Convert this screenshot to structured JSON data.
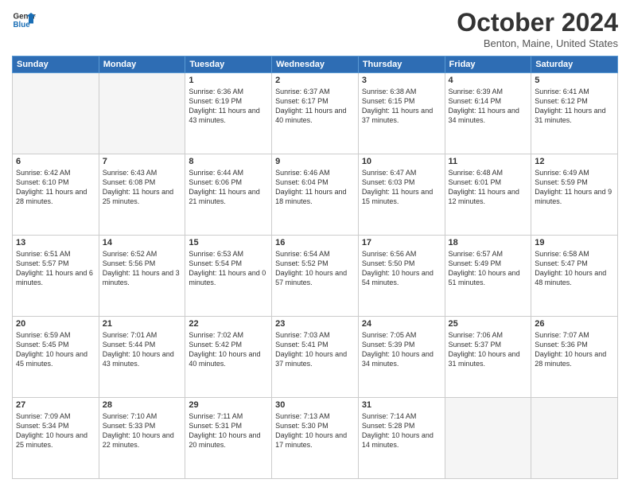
{
  "header": {
    "logo_line1": "General",
    "logo_line2": "Blue",
    "month": "October 2024",
    "location": "Benton, Maine, United States"
  },
  "weekdays": [
    "Sunday",
    "Monday",
    "Tuesday",
    "Wednesday",
    "Thursday",
    "Friday",
    "Saturday"
  ],
  "weeks": [
    [
      {
        "day": "",
        "info": ""
      },
      {
        "day": "",
        "info": ""
      },
      {
        "day": "1",
        "info": "Sunrise: 6:36 AM\nSunset: 6:19 PM\nDaylight: 11 hours\nand 43 minutes."
      },
      {
        "day": "2",
        "info": "Sunrise: 6:37 AM\nSunset: 6:17 PM\nDaylight: 11 hours\nand 40 minutes."
      },
      {
        "day": "3",
        "info": "Sunrise: 6:38 AM\nSunset: 6:15 PM\nDaylight: 11 hours\nand 37 minutes."
      },
      {
        "day": "4",
        "info": "Sunrise: 6:39 AM\nSunset: 6:14 PM\nDaylight: 11 hours\nand 34 minutes."
      },
      {
        "day": "5",
        "info": "Sunrise: 6:41 AM\nSunset: 6:12 PM\nDaylight: 11 hours\nand 31 minutes."
      }
    ],
    [
      {
        "day": "6",
        "info": "Sunrise: 6:42 AM\nSunset: 6:10 PM\nDaylight: 11 hours\nand 28 minutes."
      },
      {
        "day": "7",
        "info": "Sunrise: 6:43 AM\nSunset: 6:08 PM\nDaylight: 11 hours\nand 25 minutes."
      },
      {
        "day": "8",
        "info": "Sunrise: 6:44 AM\nSunset: 6:06 PM\nDaylight: 11 hours\nand 21 minutes."
      },
      {
        "day": "9",
        "info": "Sunrise: 6:46 AM\nSunset: 6:04 PM\nDaylight: 11 hours\nand 18 minutes."
      },
      {
        "day": "10",
        "info": "Sunrise: 6:47 AM\nSunset: 6:03 PM\nDaylight: 11 hours\nand 15 minutes."
      },
      {
        "day": "11",
        "info": "Sunrise: 6:48 AM\nSunset: 6:01 PM\nDaylight: 11 hours\nand 12 minutes."
      },
      {
        "day": "12",
        "info": "Sunrise: 6:49 AM\nSunset: 5:59 PM\nDaylight: 11 hours\nand 9 minutes."
      }
    ],
    [
      {
        "day": "13",
        "info": "Sunrise: 6:51 AM\nSunset: 5:57 PM\nDaylight: 11 hours\nand 6 minutes."
      },
      {
        "day": "14",
        "info": "Sunrise: 6:52 AM\nSunset: 5:56 PM\nDaylight: 11 hours\nand 3 minutes."
      },
      {
        "day": "15",
        "info": "Sunrise: 6:53 AM\nSunset: 5:54 PM\nDaylight: 11 hours\nand 0 minutes."
      },
      {
        "day": "16",
        "info": "Sunrise: 6:54 AM\nSunset: 5:52 PM\nDaylight: 10 hours\nand 57 minutes."
      },
      {
        "day": "17",
        "info": "Sunrise: 6:56 AM\nSunset: 5:50 PM\nDaylight: 10 hours\nand 54 minutes."
      },
      {
        "day": "18",
        "info": "Sunrise: 6:57 AM\nSunset: 5:49 PM\nDaylight: 10 hours\nand 51 minutes."
      },
      {
        "day": "19",
        "info": "Sunrise: 6:58 AM\nSunset: 5:47 PM\nDaylight: 10 hours\nand 48 minutes."
      }
    ],
    [
      {
        "day": "20",
        "info": "Sunrise: 6:59 AM\nSunset: 5:45 PM\nDaylight: 10 hours\nand 45 minutes."
      },
      {
        "day": "21",
        "info": "Sunrise: 7:01 AM\nSunset: 5:44 PM\nDaylight: 10 hours\nand 43 minutes."
      },
      {
        "day": "22",
        "info": "Sunrise: 7:02 AM\nSunset: 5:42 PM\nDaylight: 10 hours\nand 40 minutes."
      },
      {
        "day": "23",
        "info": "Sunrise: 7:03 AM\nSunset: 5:41 PM\nDaylight: 10 hours\nand 37 minutes."
      },
      {
        "day": "24",
        "info": "Sunrise: 7:05 AM\nSunset: 5:39 PM\nDaylight: 10 hours\nand 34 minutes."
      },
      {
        "day": "25",
        "info": "Sunrise: 7:06 AM\nSunset: 5:37 PM\nDaylight: 10 hours\nand 31 minutes."
      },
      {
        "day": "26",
        "info": "Sunrise: 7:07 AM\nSunset: 5:36 PM\nDaylight: 10 hours\nand 28 minutes."
      }
    ],
    [
      {
        "day": "27",
        "info": "Sunrise: 7:09 AM\nSunset: 5:34 PM\nDaylight: 10 hours\nand 25 minutes."
      },
      {
        "day": "28",
        "info": "Sunrise: 7:10 AM\nSunset: 5:33 PM\nDaylight: 10 hours\nand 22 minutes."
      },
      {
        "day": "29",
        "info": "Sunrise: 7:11 AM\nSunset: 5:31 PM\nDaylight: 10 hours\nand 20 minutes."
      },
      {
        "day": "30",
        "info": "Sunrise: 7:13 AM\nSunset: 5:30 PM\nDaylight: 10 hours\nand 17 minutes."
      },
      {
        "day": "31",
        "info": "Sunrise: 7:14 AM\nSunset: 5:28 PM\nDaylight: 10 hours\nand 14 minutes."
      },
      {
        "day": "",
        "info": ""
      },
      {
        "day": "",
        "info": ""
      }
    ]
  ]
}
